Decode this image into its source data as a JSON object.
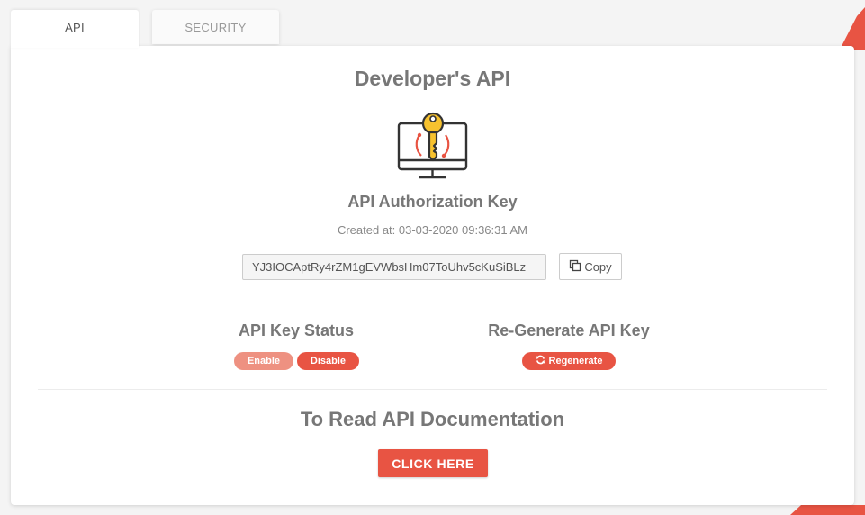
{
  "tabs": {
    "api_label": "API",
    "security_label": "SECURITY"
  },
  "main": {
    "title": "Developer's API",
    "icon": "monitor-key-icon",
    "key_section_title": "API Authorization Key",
    "created_at": "Created at: 03-03-2020 09:36:31 AM",
    "api_key_value": "YJ3IOCAptRy4rZM1gEVWbsHm07ToUhv5cKuSiBLz",
    "copy_label": "Copy",
    "copy_icon": "copy-icon"
  },
  "status": {
    "title": "API Key Status",
    "enable_label": "Enable",
    "disable_label": "Disable"
  },
  "regenerate": {
    "title": "Re-Generate API Key",
    "button_label": "Regenerate",
    "button_icon": "refresh-icon"
  },
  "docs": {
    "title": "To Read API Documentation",
    "button_label": "CLICK HERE"
  },
  "colors": {
    "accent": "#e85443",
    "accent_light": "#ee9181",
    "key_yellow": "#f7c22f"
  }
}
